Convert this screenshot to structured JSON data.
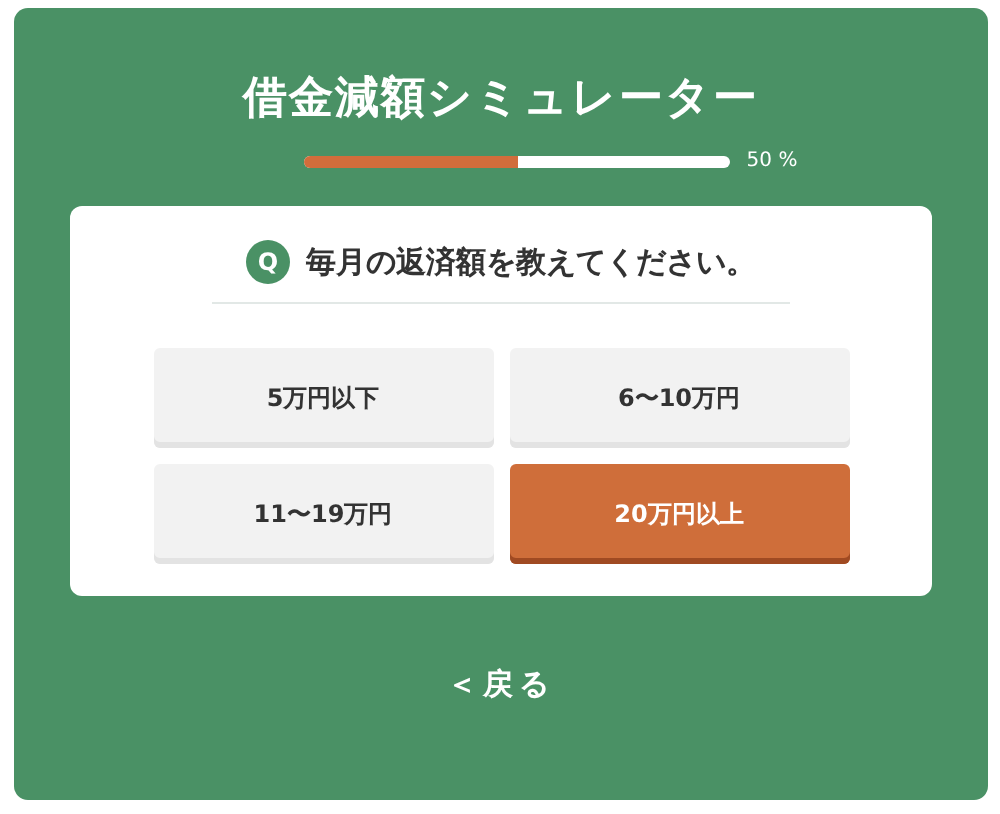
{
  "title": "借金減額シミュレーター",
  "progress": {
    "level": 0.5,
    "label": "50 %"
  },
  "question": {
    "badge": "Q",
    "text": "毎月の返済額を教えてください。"
  },
  "options": [
    {
      "label": "5万円以下",
      "selected": false
    },
    {
      "label": "6〜10万円",
      "selected": false
    },
    {
      "label": "11〜19万円",
      "selected": false
    },
    {
      "label": "20万円以上",
      "selected": true
    }
  ],
  "back_link": "＜戻る"
}
